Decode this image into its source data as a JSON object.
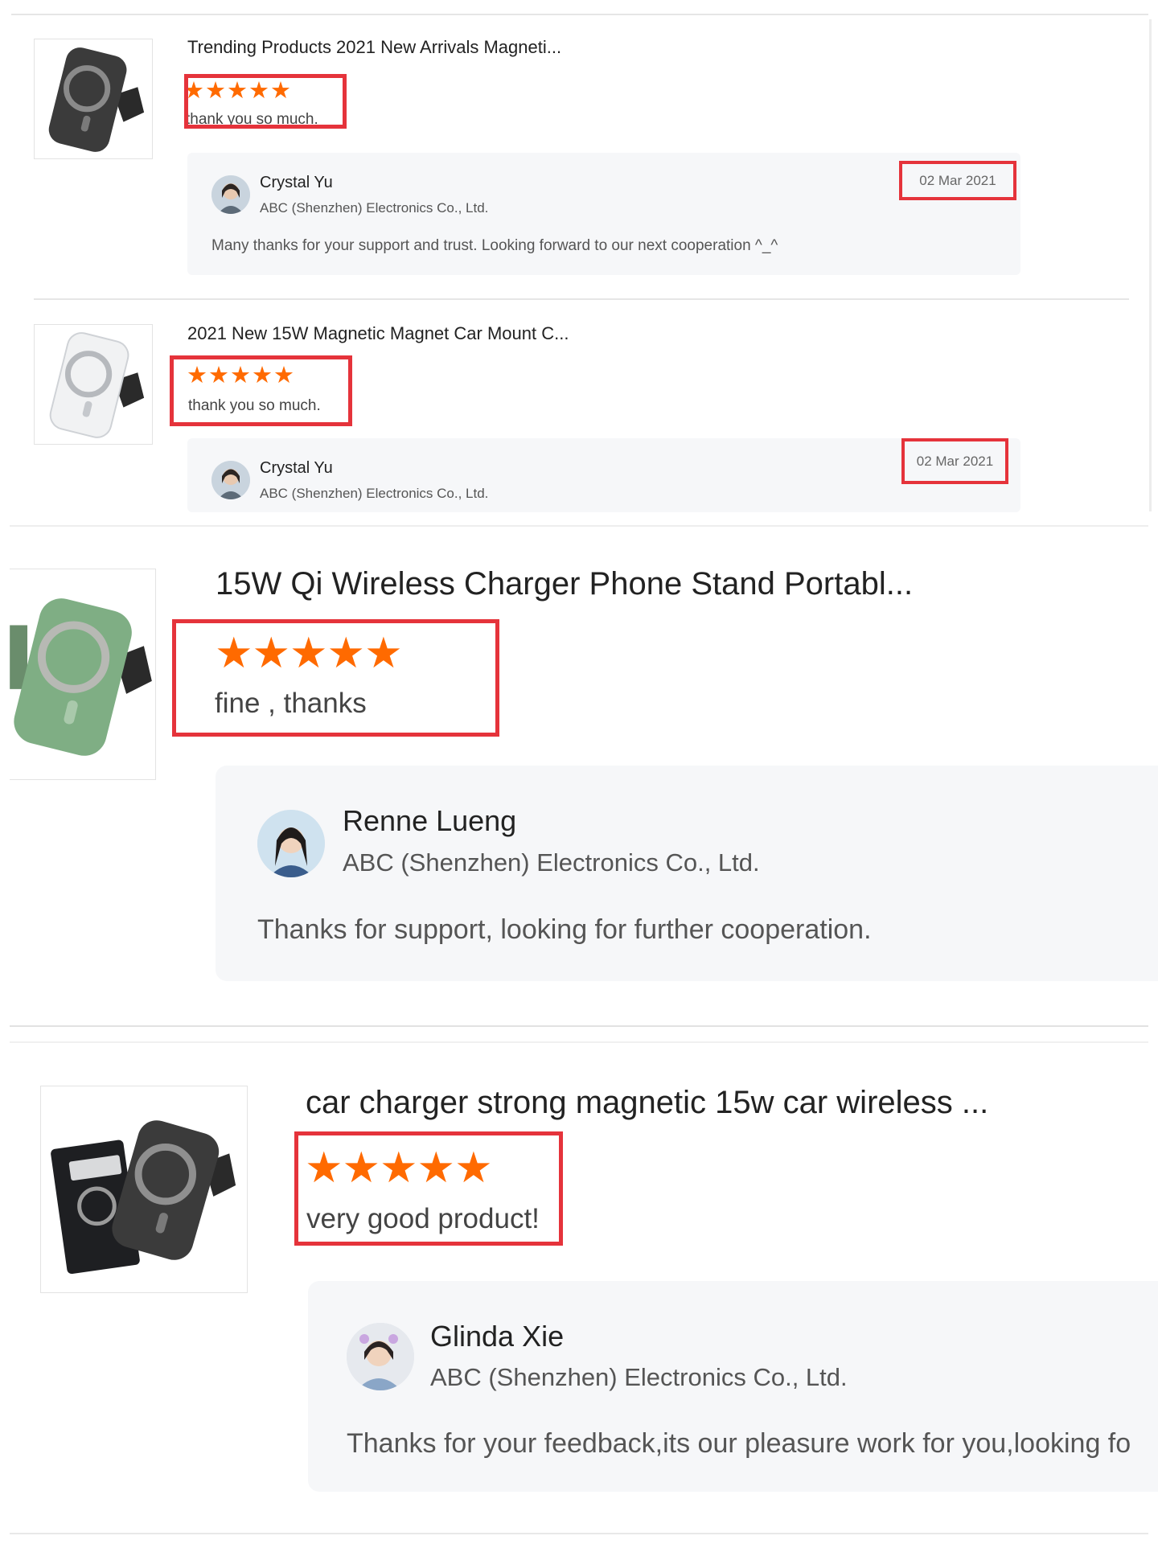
{
  "colors": {
    "highlight_border": "#e5333b",
    "star": "#ff6a00",
    "reply_bg": "#f6f7f9",
    "divider": "#e6e6e6"
  },
  "reviews": [
    {
      "product_title": "Trending Products 2021 New Arrivals Magneti...",
      "product_image": "black-magnetic-car-mount-image",
      "rating": 5,
      "review_text": "thank you so much.",
      "reply": {
        "name": "Crystal Yu",
        "company": "ABC (Shenzhen) Electronics Co., Ltd.",
        "date": "02 Mar 2021",
        "text": "Many thanks for your support and trust. Looking forward to our next cooperation ^_^"
      }
    },
    {
      "product_title": "2021 New 15W Magnetic Magnet Car Mount C...",
      "product_image": "white-magnetic-car-mount-image",
      "rating": 5,
      "review_text": "thank you so much.",
      "reply": {
        "name": "Crystal Yu",
        "company": "ABC (Shenzhen) Electronics Co., Ltd.",
        "date": "02 Mar 2021"
      }
    },
    {
      "product_title": "15W Qi Wireless Charger Phone Stand Portabl...",
      "product_image": "green-magnetic-car-mount-image",
      "rating": 5,
      "review_text": "fine , thanks",
      "reply": {
        "name": "Renne Lueng",
        "company": "ABC (Shenzhen) Electronics Co., Ltd.",
        "text": "Thanks for support, looking for further cooperation."
      }
    },
    {
      "product_title": "car charger strong magnetic 15w car wireless ...",
      "product_image": "magnetic-car-charger-with-box-image",
      "rating": 5,
      "review_text": "very good product!",
      "reply": {
        "name": "Glinda Xie",
        "company": "ABC (Shenzhen) Electronics Co., Ltd.",
        "text": "Thanks for your feedback,its our pleasure work for you,looking fo"
      }
    }
  ]
}
